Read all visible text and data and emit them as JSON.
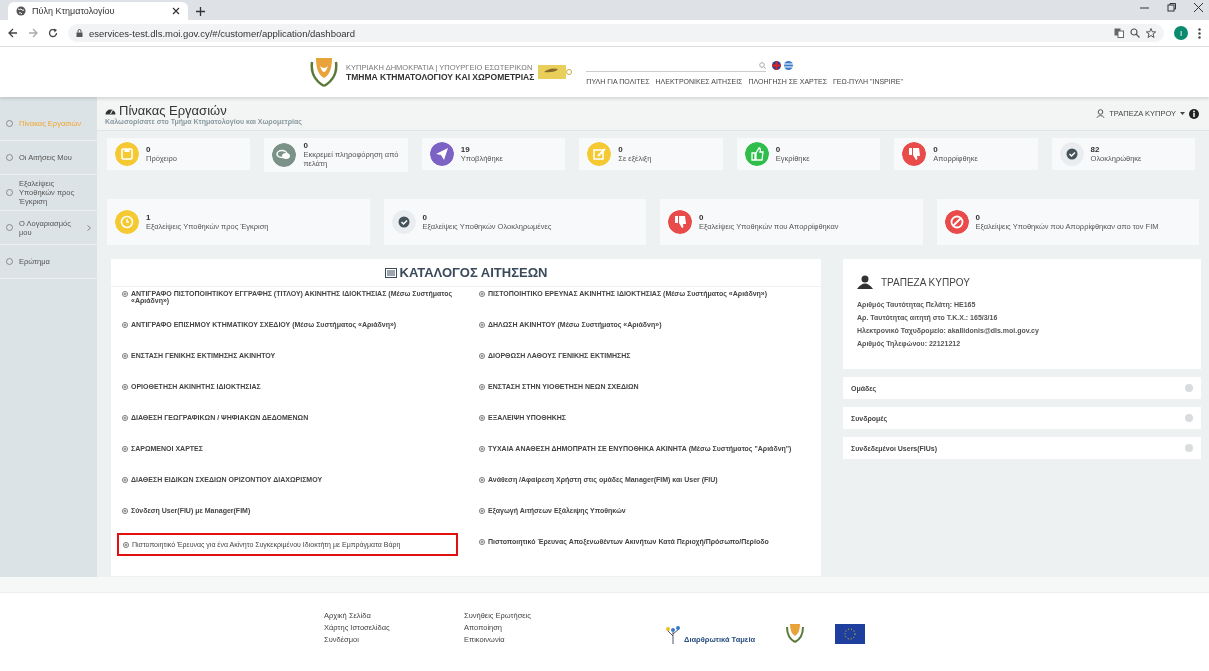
{
  "browser": {
    "tab_title": "Πύλη Κτηματολογίου",
    "url": "eservices-test.dls.moi.gov.cy/#/customer/application/dashboard",
    "profile_initial": "I"
  },
  "header": {
    "logo_line_1": "ΚΥΠΡΙΑΚΗ ΔΗΜΟΚΡΑΤΙΑ | ΥΠΟΥΡΓΕΙΟ ΕΣΩΤΕΡΙΚΩΝ",
    "logo_line_2": "ΤΜΗΜΑ ΚΤΗΜΑΤΟΛΟΓΙΟΥ ΚΑΙ ΧΩΡΟΜΕΤΡΙΑΣ",
    "nav": [
      "ΠΥΛΗ ΓΙΑ ΠΟΛΙΤΕΣ",
      "ΗΛΕΚΤΡΟΝΙΚΕΣ ΑΙΤΗΣΕΙΣ",
      "ΠΛΟΗΓΗΣΗ ΣΕ ΧΑΡΤΕΣ",
      "ΓΕΩ-ΠΥΛΗ \"INSPIRE\""
    ]
  },
  "sidebar": {
    "items": [
      {
        "label": "Πίνακας Εργασιών",
        "selected": true,
        "kind": "link"
      },
      {
        "label": "Οι Αιτήσεις Μου",
        "selected": false,
        "kind": "link"
      },
      {
        "label": "Εξαλείψεις Υποθηκών προς Έγκριση",
        "selected": false,
        "kind": "link"
      },
      {
        "label": "Ο Λογαριασμός μου",
        "selected": false,
        "kind": "submenu"
      },
      {
        "label": "Ερώτημα",
        "selected": false,
        "kind": "link"
      }
    ]
  },
  "page": {
    "title": "Πίνακας Εργασιών",
    "subtitle": "Καλωσορίσατε στο Τμήμα Κτηματολογίου και Χωρομετρίας",
    "user": "ΤΡΑΠΕΖΑ ΚΥΠΡΟΥ"
  },
  "stats_row_1": [
    {
      "count": "0",
      "label": "Πρόχειρο",
      "color": "#f5c932"
    },
    {
      "count": "0",
      "label": "Εκκρεμεί πληροφόρηση από πελάτη",
      "color": "#7a9288"
    },
    {
      "count": "19",
      "label": "Υποβλήθηκε",
      "color": "#7c62c4"
    },
    {
      "count": "0",
      "label": "Σε εξέλιξη",
      "color": "#f5c932"
    },
    {
      "count": "0",
      "label": "Εγκρίθηκε",
      "color": "#2fbd4c"
    },
    {
      "count": "0",
      "label": "Απορρίφθηκε",
      "color": "#e94b4b"
    },
    {
      "count": "82",
      "label": "Ολοκληρώθηκε",
      "color": "#e9edf0"
    }
  ],
  "stats_row_2": [
    {
      "count": "1",
      "label": "Εξαλείψεις Υποθηκών προς Έγκριση",
      "color": "#f5c932"
    },
    {
      "count": "0",
      "label": "Εξαλείψεις Υποθηκών Ολοκληρωμένες",
      "color": "#e9edf0"
    },
    {
      "count": "0",
      "label": "Εξαλείψεις Υποθηκών που Απορρίφθηκαν",
      "color": "#e94b4b"
    },
    {
      "count": "0",
      "label": "Εξαλείψεις Υποθηκών που Απορρίφθηκαν απο τον FIM",
      "color": "#e94b4b"
    }
  ],
  "catalog": {
    "title": "ΚΑΤΑΛΟΓΟΣ ΑΙΤΗΣΕΩΝ",
    "items": [
      {
        "label": "ΑΝΤΙΓΡΑΦΟ ΠΙΣΤΟΠΟΙΗΤΙΚΟΥ ΕΓΓΡΑΦΗΣ (ΤΙΤΛΟΥ) ΑΚΙΝΗΤΗΣ ΙΔΙΟΚΤΗΣΙΑΣ (Μέσω Συστήματος «Αριάδνη»)",
        "highlighted": false
      },
      {
        "label": "ΠΙΣΤΟΠΟΙΗΤΙΚΟ ΕΡΕΥΝΑΣ ΑΚΙΝΗΤΗΣ ΙΔΙΟΚΤΗΣΙΑΣ (Μέσω Συστήματος «Αριάδνη»)",
        "highlighted": false
      },
      {
        "label": "ΑΝΤΙΓΡΑΦΟ ΕΠΙΣΗΜΟΥ ΚΤΗΜΑΤΙΚΟΥ ΣΧΕΔΙΟΥ (Μέσω Συστήματος «Αριάδνη»)",
        "highlighted": false
      },
      {
        "label": "ΔΗΛΩΣΗ ΑΚΙΝΗΤΟΥ (Μέσω Συστήματος «Αριάδνη»)",
        "highlighted": false
      },
      {
        "label": "ΕΝΣΤΑΣΗ ΓΕΝΙΚΗΣ ΕΚΤΙΜΗΣΗΣ ΑΚΙΝΗΤΟΥ",
        "highlighted": false
      },
      {
        "label": "ΔΙΟΡΘΩΣΗ ΛΑΘΟΥΣ ΓΕΝΙΚΗΣ ΕΚΤΙΜΗΣΗΣ",
        "highlighted": false
      },
      {
        "label": "ΟΡΙΟΘΕΤΗΣΗ ΑΚΙΝΗΤΗΣ ΙΔΙΟΚΤΗΣΙΑΣ",
        "highlighted": false
      },
      {
        "label": "ΕΝΣΤΑΣΗ ΣΤΗΝ ΥΙΟΘΕΤΗΣΗ ΝΕΩΝ ΣΧΕΔΙΩΝ",
        "highlighted": false
      },
      {
        "label": "ΔΙΑΘΕΣΗ ΓΕΩΓΡΑΦΙΚΩΝ / ΨΗΦΙΑΚΩΝ ΔΕΔΟΜΕΝΩΝ",
        "highlighted": false
      },
      {
        "label": "ΕΞΑΛΕΙΨΗ ΥΠΟΘΗΚΗΣ",
        "highlighted": false
      },
      {
        "label": "ΣΑΡΩΜΕΝΟΙ ΧΑΡΤΕΣ",
        "highlighted": false
      },
      {
        "label": "ΤΥΧΑΙΑ ΑΝΑΘΕΣΗ ΔΗΜΟΠΡΑΤΗ ΣΕ ΕΝΥΠΟΘΗΚΑ ΑΚΙΝΗΤΑ (Μέσω Συστήματος \"Αριάδνη\")",
        "highlighted": false
      },
      {
        "label": "ΔΙΑΘΕΣΗ ΕΙΔΙΚΩΝ ΣΧΕΔΙΩΝ ΟΡΙΖΟΝΤΙΟΥ ΔΙΑΧΩΡΙΣΜΟΥ",
        "highlighted": false
      },
      {
        "label": "Ανάθεση /Αφαίρεση Χρήστη στις ομάδες Manager(FIM) και User (FIU)",
        "highlighted": false
      },
      {
        "label": "Σύνδεση User(FIU) με Manager(FIM)",
        "highlighted": false
      },
      {
        "label": "Εξαγωγή Αιτήσεων Εξάλειψης Υποθηκών",
        "highlighted": false
      },
      {
        "label": "Πιστοποιητικό Έρευνας για ένα Ακίνητο Συγκεκριμένου Ιδιοκτήτη με Εμπράγματα Βάρη",
        "highlighted": true
      },
      {
        "label": "Πιστοποιητικό Έρευνας Αποξενωθέντων Ακινήτων Κατά Περιοχή/Πρόσωπο/Περίοδο",
        "highlighted": false
      }
    ]
  },
  "profile": {
    "name": "ΤΡΑΠΕΖΑ ΚΥΠΡΟΥ",
    "details": [
      "Αριθμός Ταυτότητας Πελάτη: HE165",
      "Αρ. Ταυτότητας αιτητή στο Τ.Κ.Χ.: 165/3/16",
      "Ηλεκτρονικό Ταχυδρομείο: akallidonis@dls.moi.gov.cy",
      "Αριθμός Τηλεφώνου: 22121212"
    ]
  },
  "accordions": [
    {
      "label": "Ομάδες",
      "expanded": false
    },
    {
      "label": "Συνδρομές",
      "expanded": false
    },
    {
      "label": "Συνδεδεμένοι Users(FIUs)",
      "expanded": false
    }
  ],
  "footer": {
    "column_1": [
      "Αρχική Σελίδα",
      "Χάρτης Ιστοσελίδας",
      "Συνδέσμοι"
    ],
    "column_2": [
      "Συνήθεις Ερωτήσεις",
      "Αποποίηση",
      "Επικοινωνία"
    ],
    "fund_logo_text": "Διαρθρωτικά Ταμεία"
  }
}
